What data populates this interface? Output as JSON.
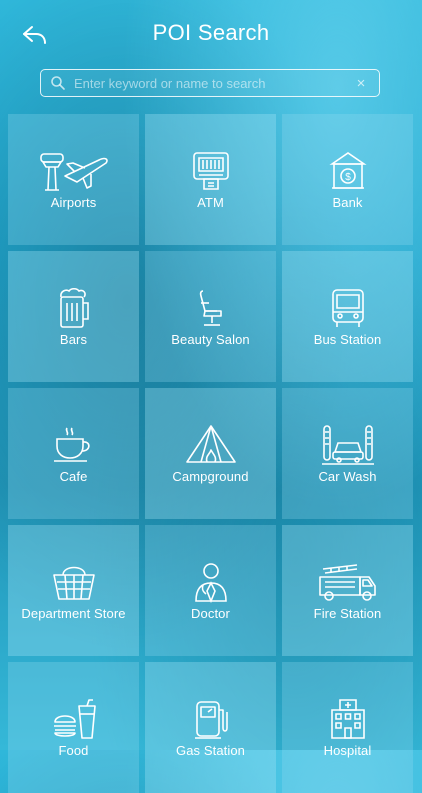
{
  "header": {
    "title": "POI Search",
    "back_icon": "back-arrow-icon"
  },
  "search": {
    "placeholder": "Enter keyword or name to search",
    "value": "",
    "clear": "×"
  },
  "categories": [
    {
      "label": "Airports",
      "icon": "airport-icon"
    },
    {
      "label": "ATM",
      "icon": "atm-icon"
    },
    {
      "label": "Bank",
      "icon": "bank-icon"
    },
    {
      "label": "Bars",
      "icon": "beer-mug-icon"
    },
    {
      "label": "Beauty Salon",
      "icon": "salon-chair-icon"
    },
    {
      "label": "Bus Station",
      "icon": "bus-icon"
    },
    {
      "label": "Cafe",
      "icon": "coffee-cup-icon"
    },
    {
      "label": "Campground",
      "icon": "tent-icon"
    },
    {
      "label": "Car Wash",
      "icon": "car-wash-icon"
    },
    {
      "label": "Department Store",
      "icon": "shopping-basket-icon"
    },
    {
      "label": "Doctor",
      "icon": "doctor-icon"
    },
    {
      "label": "Fire Station",
      "icon": "fire-truck-icon"
    },
    {
      "label": "Food",
      "icon": "burger-drink-icon"
    },
    {
      "label": "Gas Station",
      "icon": "fuel-pump-icon"
    },
    {
      "label": "Hospital",
      "icon": "hospital-building-icon"
    }
  ],
  "colors": {
    "accent": "#2aa9cf",
    "text": "#ffffff"
  }
}
